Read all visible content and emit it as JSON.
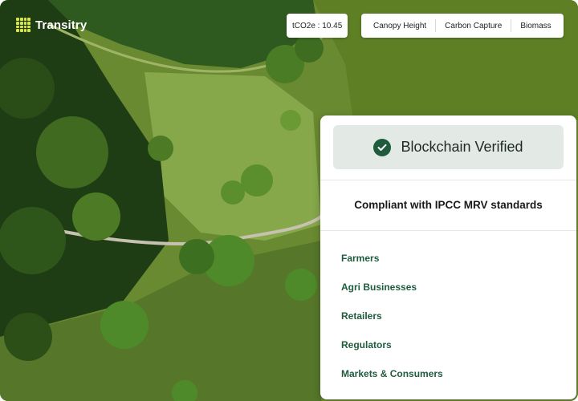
{
  "brand": {
    "name": "Transitry",
    "logo": "green-grid-logo"
  },
  "metric": {
    "label": "tCO2e : 10.45"
  },
  "tabs": [
    {
      "label": "Canopy Height"
    },
    {
      "label": "Carbon Capture"
    },
    {
      "label": "Biomass"
    }
  ],
  "panel": {
    "status": {
      "label": "Blockchain Verified",
      "icon": "check-circle-icon"
    },
    "compliance": "Compliant with IPCC MRV standards",
    "stakeholders": [
      {
        "label": "Farmers"
      },
      {
        "label": "Agri Businesses"
      },
      {
        "label": "Retailers"
      },
      {
        "label": "Regulators"
      },
      {
        "label": "Markets & Consumers"
      }
    ]
  },
  "colors": {
    "accent": "#1f5c3e",
    "logo": "#d8e64a",
    "badge_bg": "#e3eae6"
  }
}
